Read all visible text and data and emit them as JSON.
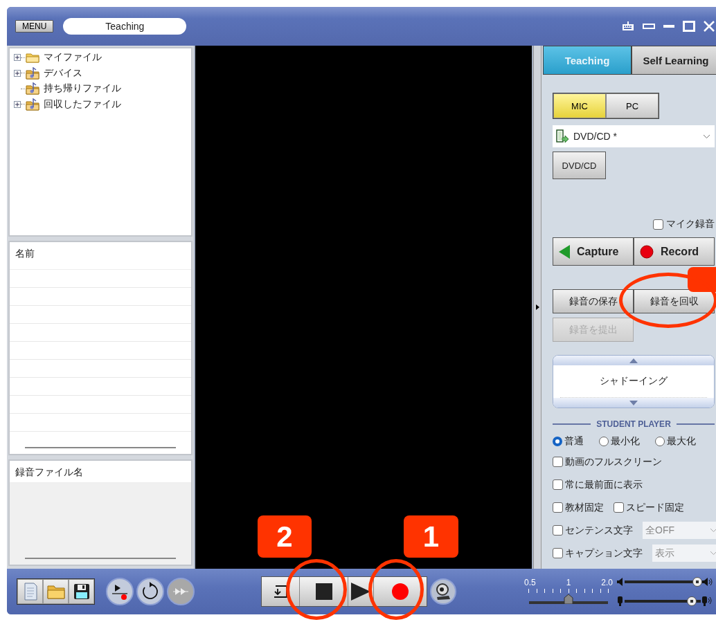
{
  "window": {
    "menu_button": "MENU",
    "title": "Teaching"
  },
  "file_tree": [
    {
      "label": "マイファイル",
      "kind": "folder",
      "expandable": true
    },
    {
      "label": "デバイス",
      "kind": "music-folder",
      "expandable": true
    },
    {
      "label": "持ち帰りファイル",
      "kind": "music-folder",
      "expandable": false
    },
    {
      "label": "回収したファイル",
      "kind": "music-folder",
      "expandable": true
    }
  ],
  "name_list": {
    "header": "名前"
  },
  "recording_list": {
    "header": "録音ファイル名"
  },
  "tabs": [
    {
      "label": "Teaching",
      "selected": true
    },
    {
      "label": "Self Learning",
      "selected": false
    }
  ],
  "source_toggle": [
    {
      "label": "MIC",
      "selected": true
    },
    {
      "label": "PC",
      "selected": false
    }
  ],
  "source_select": {
    "value": "DVD/CD *"
  },
  "dvd_button": "DVD/CD",
  "mic_record": {
    "label": "マイク録音",
    "checked": false
  },
  "capture_button": "Capture",
  "record_button": "Record",
  "recording_buttons": [
    {
      "label": "録音の保存",
      "disabled": false
    },
    {
      "label": "録音を回収",
      "disabled": false
    },
    {
      "label": "録音を提出",
      "disabled": true
    }
  ],
  "mode_list": {
    "item": "シャドーイング"
  },
  "student_player": {
    "heading": "STUDENT PLAYER",
    "size_options": [
      {
        "label": "普通",
        "selected": true
      },
      {
        "label": "最小化",
        "selected": false
      },
      {
        "label": "最大化",
        "selected": false
      }
    ],
    "option_rows": [
      {
        "items": [
          {
            "label": "動画のフルスクリーン",
            "checked": false
          }
        ]
      },
      {
        "items": [
          {
            "label": "常に最前面に表示",
            "checked": false
          }
        ]
      },
      {
        "items": [
          {
            "label": "教材固定",
            "checked": false
          },
          {
            "label": "スピード固定",
            "checked": false
          }
        ]
      },
      {
        "items": [
          {
            "label": "センテンス文字",
            "checked": false
          }
        ],
        "select": "全OFF"
      },
      {
        "items": [
          {
            "label": "キャプション文字",
            "checked": false
          }
        ],
        "select": "表示"
      }
    ]
  },
  "speed": {
    "ticks": [
      "0.5",
      "1",
      "2.0"
    ],
    "level": 0.5
  },
  "volume": {
    "level": 0.95
  },
  "mic_volume": {
    "level": 0.88
  },
  "annotations": [
    {
      "kind": "stop-callout",
      "label": "2"
    },
    {
      "kind": "record-callout",
      "label": "1"
    },
    {
      "kind": "collect-callout"
    }
  ]
}
